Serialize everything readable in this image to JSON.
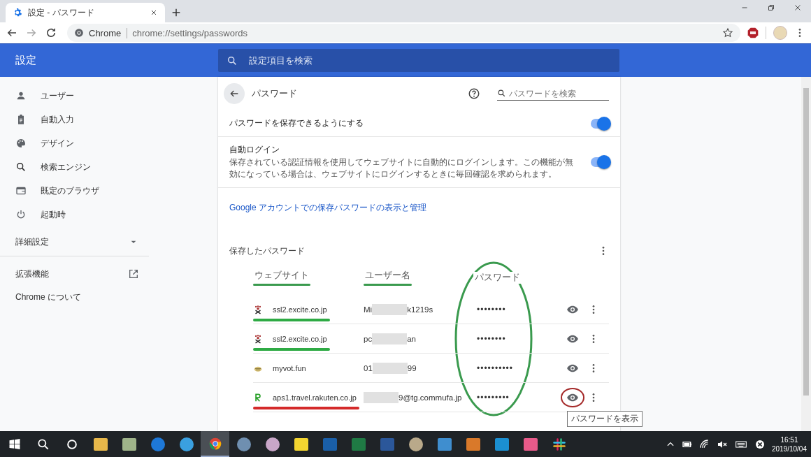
{
  "browser": {
    "tab": {
      "title": "設定 - パスワード",
      "selected": true
    },
    "omnibox": {
      "site_label": "Chrome",
      "url": "chrome://settings/passwords"
    }
  },
  "header": {
    "title": "設定",
    "search_placeholder": "設定項目を検索"
  },
  "sidebar": {
    "items": [
      {
        "label": "ユーザー"
      },
      {
        "label": "自動入力"
      },
      {
        "label": "デザイン"
      },
      {
        "label": "検索エンジン"
      },
      {
        "label": "既定のブラウザ"
      },
      {
        "label": "起動時"
      }
    ],
    "advanced": {
      "label": "詳細設定",
      "expanded": false
    },
    "extensions": "拡張機能",
    "about": "Chrome について"
  },
  "page": {
    "title": "パスワード",
    "search_placeholder": "パスワードを検索",
    "settings": [
      {
        "label": "パスワードを保存できるようにする",
        "on": true
      },
      {
        "label": "自動ログイン",
        "description": "保存されている認証情報を使用してウェブサイトに自動的にログインします。この機能が無効になっている場合は、ウェブサイトにログインするときに毎回確認を求められます。",
        "on": true
      }
    ],
    "link": "Google アカウントでの保存パスワードの表示と管理",
    "saved_title": "保存したパスワード",
    "columns": [
      {
        "label": "ウェブサイト",
        "underline": {
          "color": "#3a9a4e"
        }
      },
      {
        "label": "ユーザー名",
        "underline": {
          "color": "#3a9a4e"
        }
      },
      {
        "label": "パスワード"
      }
    ],
    "password_column_ellipse": {
      "color": "#3a9a4e"
    },
    "rows": [
      {
        "kind": "paw",
        "site": "ssl2.excite.co.jp",
        "user_start": "Mi",
        "user_end": "k1219s",
        "password": "••••••••",
        "site_underline": {
          "color": "#2eaa44"
        }
      },
      {
        "kind": "paw",
        "site": "ssl2.excite.co.jp",
        "user_start": "pc",
        "user_end": "an",
        "password": "••••••••",
        "site_underline": {
          "color": "#2eaa44"
        }
      },
      {
        "kind": "dish",
        "site": "myvot.fun",
        "user_start": "01",
        "user_end": "99",
        "password": "••••••••••"
      },
      {
        "kind": "letter",
        "site": "aps1.travel.rakuten.co.jp",
        "user_end": "9@tg.commufa.jp",
        "password": "•••••••••",
        "site_underline": {
          "color": "#d42a2a"
        },
        "eye_circle": {
          "color": "#a52a2a"
        }
      }
    ],
    "tooltip": "パスワードを表示"
  },
  "taskbar": {
    "apps": [
      {
        "kind": "start"
      },
      {
        "kind": "search"
      },
      {
        "kind": "cortana"
      },
      {
        "kind": "tile",
        "color": "#e8b84a"
      },
      {
        "kind": "tile",
        "color": "#9fb48a"
      },
      {
        "kind": "round",
        "color": "#1e78d7"
      },
      {
        "kind": "round",
        "color": "#3aa0e0"
      },
      {
        "kind": "chrome",
        "selected": true
      },
      {
        "kind": "round",
        "color": "#6f8fb0"
      },
      {
        "kind": "round",
        "color": "#c9a6c8"
      },
      {
        "kind": "tile",
        "color": "#f3d530"
      },
      {
        "kind": "tile",
        "color": "#1a5fa8"
      },
      {
        "kind": "tile",
        "color": "#1f7a44"
      },
      {
        "kind": "tile",
        "color": "#2b579a"
      },
      {
        "kind": "round",
        "color": "#b9a98a"
      },
      {
        "kind": "tile",
        "color": "#3f8ecf"
      },
      {
        "kind": "tile",
        "color": "#d9792a"
      },
      {
        "kind": "tile",
        "color": "#1b8fd1"
      },
      {
        "kind": "tile",
        "color": "#e85a8a"
      },
      {
        "kind": "slack"
      }
    ],
    "time": "16:51",
    "date": "2019/10/04"
  }
}
